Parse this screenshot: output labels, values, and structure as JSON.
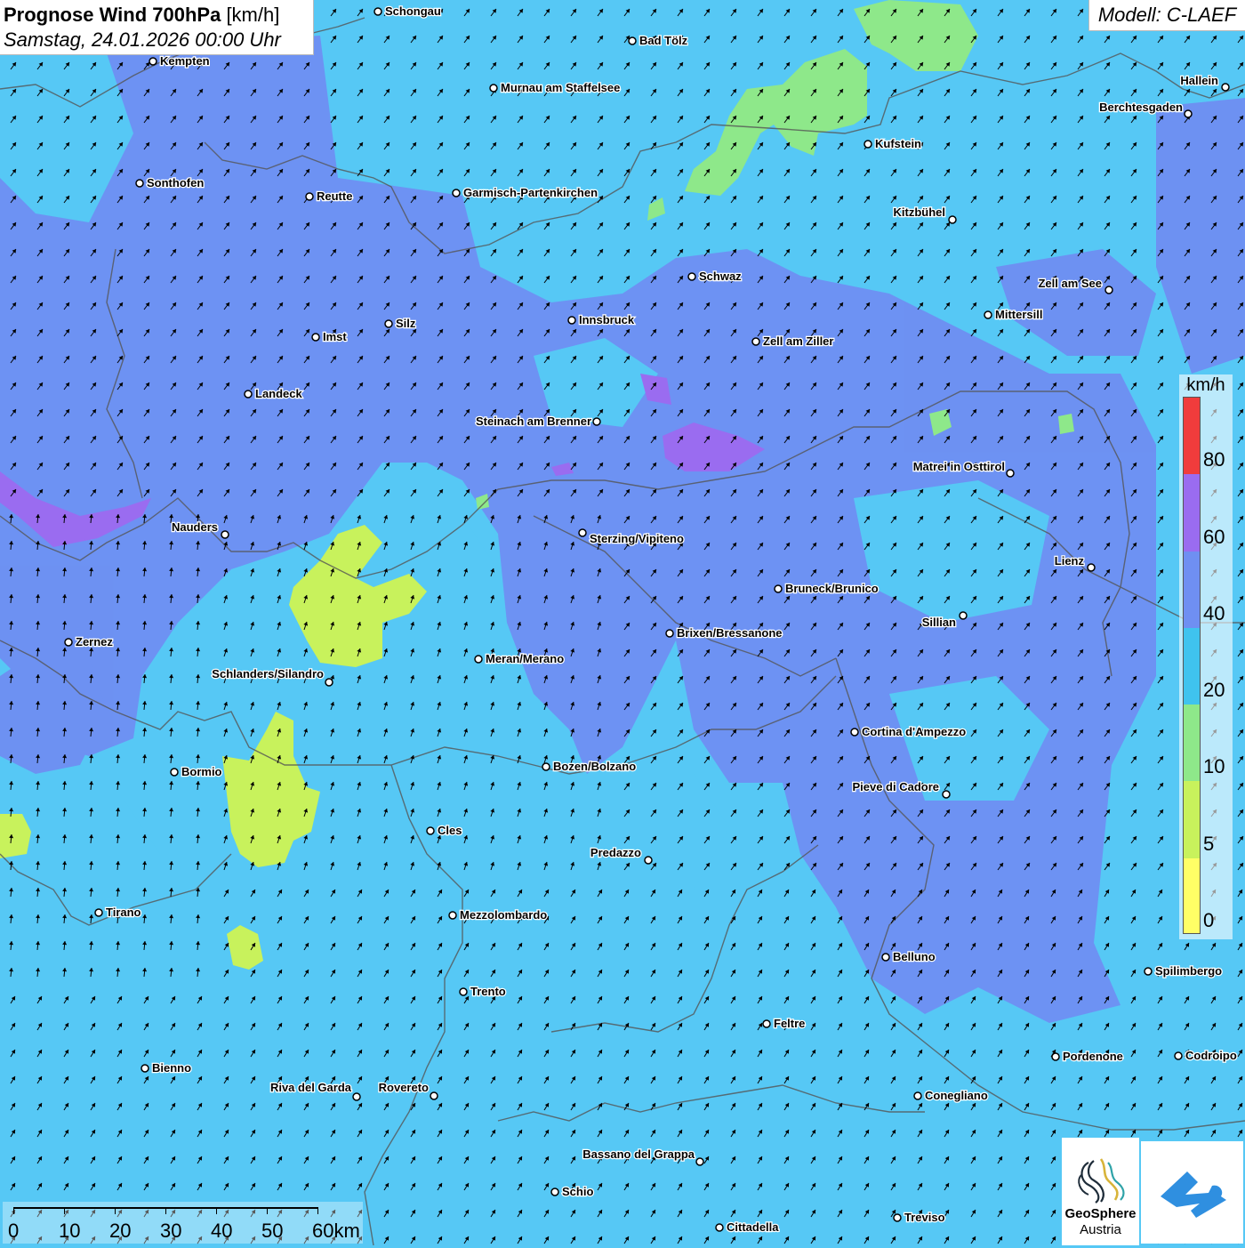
{
  "header": {
    "title_bold": "Prognose Wind 700hPa",
    "title_unit": "[km/h]",
    "subtitle": "Samstag, 24.01.2026 00:00 Uhr",
    "model": "Modell: C-LAEF"
  },
  "legend": {
    "unit": "km/h",
    "bands": [
      {
        "label": "80",
        "color": "#f03c3c"
      },
      {
        "label": "60",
        "color": "#9a6cf0"
      },
      {
        "label": "40",
        "color": "#6f8ff2"
      },
      {
        "label": "20",
        "color": "#3fc3ee"
      },
      {
        "label": "10",
        "color": "#8ee88a"
      },
      {
        "label": "5",
        "color": "#c8f25c"
      },
      {
        "label": "0",
        "color": "#ffff66"
      }
    ],
    "labels": [
      "80",
      "60",
      "40",
      "20",
      "10",
      "5",
      "0"
    ]
  },
  "scale_bar": {
    "labels": [
      "0",
      "10",
      "20",
      "30",
      "40",
      "50",
      "60km"
    ]
  },
  "logos": {
    "geosphere_line1": "GeoSphere",
    "geosphere_line2": "Austria"
  },
  "colors": {
    "background": "#56c8f5",
    "speed_20_40": "#6f8ff2",
    "speed_60_80": "#9a6cf0",
    "speed_5_10": "#c8f25c",
    "speed_10_20": "#8ee88a",
    "border": "#555555",
    "arrow": "#000000"
  },
  "cities": [
    "Schongau",
    "Kempten",
    "Bad Tölz",
    "Murnau am Staffelsee",
    "Hallein",
    "Berchtesgaden",
    "Kufstein",
    "Sonthofen",
    "Reutte",
    "Garmisch-Partenkirchen",
    "Kitzbühel",
    "Schwaz",
    "Zell am See",
    "Mittersill",
    "Innsbruck",
    "Silz",
    "Imst",
    "Zell am Ziller",
    "Landeck",
    "Steinach am Brenner",
    "Matrei in Osttirol",
    "Nauders",
    "Sterzing/Vipiteno",
    "Lienz",
    "Bruneck/Brunico",
    "Sillian",
    "Zernez",
    "Brixen/Bressanone",
    "Meran/Merano",
    "Schlanders/Silandro",
    "Cortina d'Ampezzo",
    "Bozen/Bolzano",
    "Bormio",
    "Pieve di Cadore",
    "Cles",
    "Predazzo",
    "Tirano",
    "Mezzolombardo",
    "Belluno",
    "Spilimbergo",
    "Trento",
    "Feltre",
    "Pordenone",
    "Codroipo",
    "Bienno",
    "Riva del Garda",
    "Rovereto",
    "Conegliano",
    "Bassano del Grappa",
    "Schio",
    "Treviso",
    "Cittadella"
  ]
}
